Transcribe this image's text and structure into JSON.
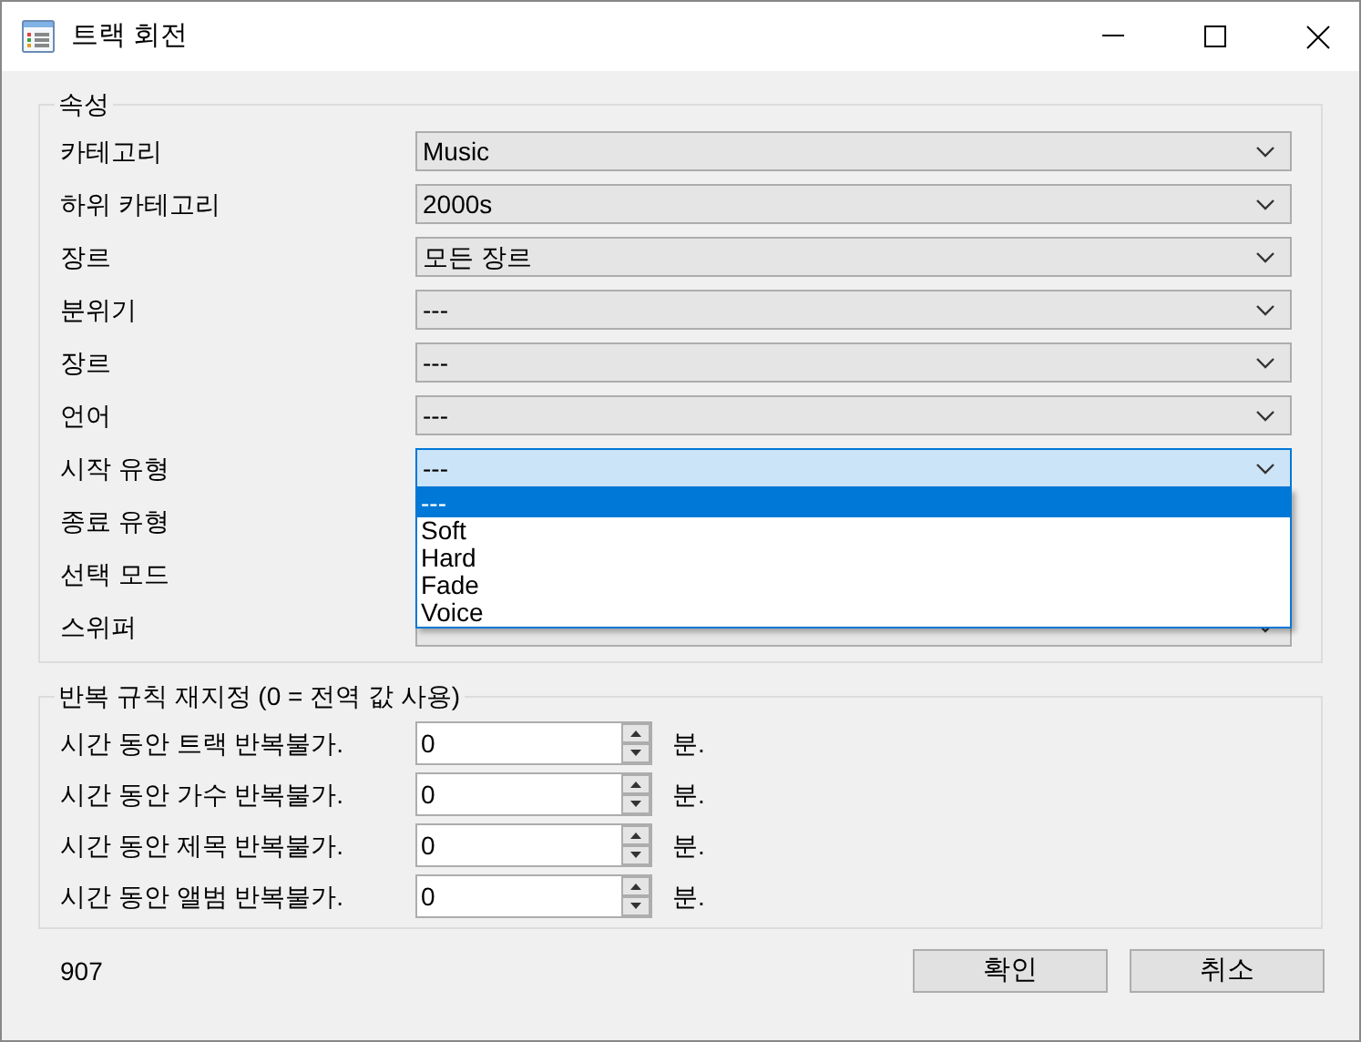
{
  "window": {
    "title": "트랙 회전"
  },
  "properties": {
    "title": "속성",
    "rows": [
      {
        "label": "카테고리",
        "value": "Music",
        "expanded": false
      },
      {
        "label": "하위 카테고리",
        "value": "2000s",
        "expanded": false
      },
      {
        "label": "장르",
        "value": "모든 장르",
        "expanded": false
      },
      {
        "label": "분위기",
        "value": "---",
        "expanded": false
      },
      {
        "label": "장르",
        "value": "---",
        "expanded": false
      },
      {
        "label": "언어",
        "value": "---",
        "expanded": false
      },
      {
        "label": "시작 유형",
        "value": "---",
        "expanded": true,
        "options": [
          {
            "label": "---",
            "selected": true
          },
          {
            "label": "Soft",
            "selected": false
          },
          {
            "label": "Hard",
            "selected": false
          },
          {
            "label": "Fade",
            "selected": false
          },
          {
            "label": "Voice",
            "selected": false
          }
        ]
      },
      {
        "label": "종료 유형"
      },
      {
        "label": "선택 모드"
      },
      {
        "label": "스위퍼",
        "expanded": false
      }
    ]
  },
  "repeat_rules": {
    "title": "반복 규칙 재지정 (0 = 전역 값 사용)",
    "rows": [
      {
        "label": "시간 동안 트랙 반복불가.",
        "value": "0",
        "unit": "분."
      },
      {
        "label": "시간 동안 가수 반복불가.",
        "value": "0",
        "unit": "분."
      },
      {
        "label": "시간 동안 제목 반복불가.",
        "value": "0",
        "unit": "분."
      },
      {
        "label": "시간 동안 앨범 반복불가.",
        "value": "0",
        "unit": "분."
      }
    ]
  },
  "footer": {
    "count": "907",
    "buttons": [
      "확인",
      "취소"
    ]
  }
}
